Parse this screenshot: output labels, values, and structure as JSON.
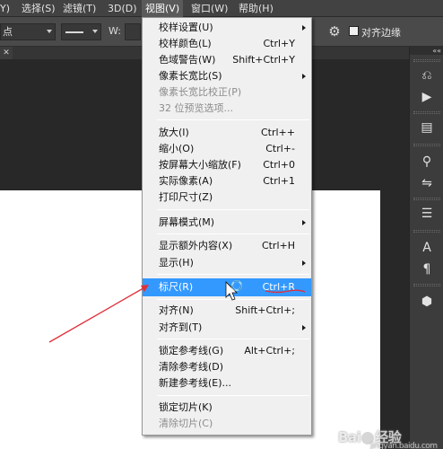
{
  "menubar": {
    "items": [
      {
        "label": "Y)"
      },
      {
        "label": "选择(S)"
      },
      {
        "label": "滤镜(T)"
      },
      {
        "label": "3D(D)"
      },
      {
        "label": "视图(V)"
      },
      {
        "label": "窗口(W)"
      },
      {
        "label": "帮助(H)"
      }
    ]
  },
  "options": {
    "unit_dropdown_value": "点",
    "width_label": "W:",
    "align_edges_label": "对齐边缘"
  },
  "view_menu": {
    "items": [
      {
        "label": "校样设置(U)",
        "shortcut": "",
        "submenu": true,
        "disabled": false
      },
      {
        "label": "校样颜色(L)",
        "shortcut": "Ctrl+Y",
        "submenu": false,
        "disabled": false
      },
      {
        "label": "色域警告(W)",
        "shortcut": "Shift+Ctrl+Y",
        "submenu": false,
        "disabled": false
      },
      {
        "label": "像素长宽比(S)",
        "shortcut": "",
        "submenu": true,
        "disabled": false
      },
      {
        "label": "像素长宽比校正(P)",
        "shortcut": "",
        "submenu": false,
        "disabled": true
      },
      {
        "label": "32 位预览选项...",
        "shortcut": "",
        "submenu": false,
        "disabled": true
      },
      {
        "label": "放大(I)",
        "shortcut": "Ctrl++",
        "submenu": false,
        "disabled": false
      },
      {
        "label": "缩小(O)",
        "shortcut": "Ctrl+-",
        "submenu": false,
        "disabled": false
      },
      {
        "label": "按屏幕大小缩放(F)",
        "shortcut": "Ctrl+0",
        "submenu": false,
        "disabled": false
      },
      {
        "label": "实际像素(A)",
        "shortcut": "Ctrl+1",
        "submenu": false,
        "disabled": false
      },
      {
        "label": "打印尺寸(Z)",
        "shortcut": "",
        "submenu": false,
        "disabled": false
      },
      {
        "label": "屏幕模式(M)",
        "shortcut": "",
        "submenu": true,
        "disabled": false
      },
      {
        "label": "显示额外内容(X)",
        "shortcut": "Ctrl+H",
        "submenu": false,
        "disabled": false
      },
      {
        "label": "显示(H)",
        "shortcut": "",
        "submenu": true,
        "disabled": false
      },
      {
        "label": "标尺(R)",
        "shortcut": "Ctrl+R",
        "submenu": false,
        "disabled": false,
        "highlighted": true
      },
      {
        "label": "对齐(N)",
        "shortcut": "Shift+Ctrl+;",
        "submenu": false,
        "disabled": false
      },
      {
        "label": "对齐到(T)",
        "shortcut": "",
        "submenu": true,
        "disabled": false
      },
      {
        "label": "锁定参考线(G)",
        "shortcut": "Alt+Ctrl+;",
        "submenu": false,
        "disabled": false
      },
      {
        "label": "清除参考线(D)",
        "shortcut": "",
        "submenu": false,
        "disabled": false
      },
      {
        "label": "新建参考线(E)...",
        "shortcut": "",
        "submenu": false,
        "disabled": false
      },
      {
        "label": "锁定切片(K)",
        "shortcut": "",
        "submenu": false,
        "disabled": false
      },
      {
        "label": "清除切片(C)",
        "shortcut": "",
        "submenu": false,
        "disabled": true
      }
    ]
  },
  "right_panel": {
    "icons": [
      "history-icon",
      "play-action-icon",
      "layer-comps-icon",
      "brush-icon",
      "adjust-icon",
      "align-icon",
      "character-icon",
      "paragraph-icon",
      "3d-cube-icon"
    ]
  },
  "watermark": {
    "text_main": "Bai",
    "text_mid": "经验",
    "text_small": "jingyan.baidu.com"
  },
  "colors": {
    "highlight": "#3399ff",
    "annotation_red": "#e0303a",
    "ui_dark": "#282828"
  }
}
